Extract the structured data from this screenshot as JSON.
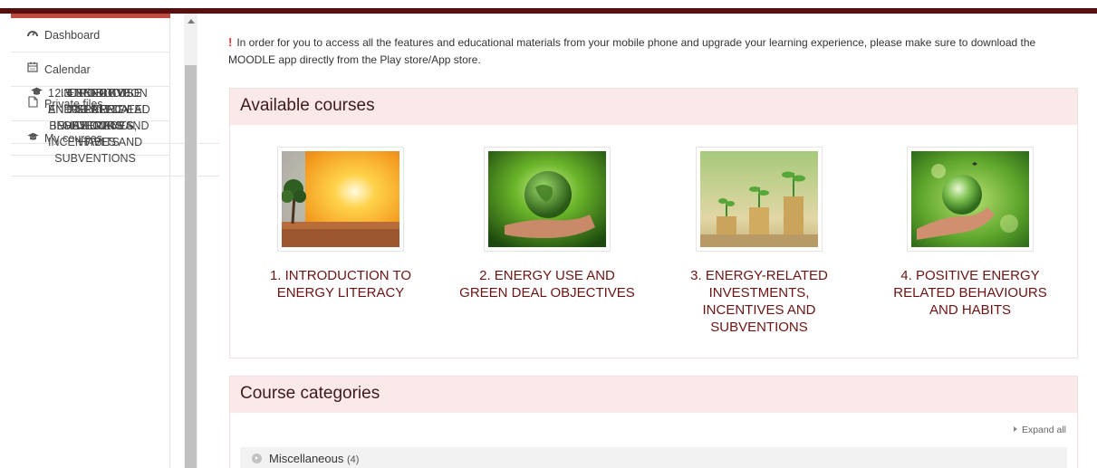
{
  "sidebar": {
    "items": [
      {
        "label": "Dashboard",
        "icon": "dashboard-icon"
      },
      {
        "label": "Calendar",
        "icon": "calendar-icon"
      },
      {
        "label": "Private files",
        "icon": "file-icon"
      },
      {
        "label": "My courses",
        "icon": "graduation-cap-icon"
      }
    ],
    "courses": [
      {
        "lines": [
          "1. INTRODUCTION",
          "TO ENERGY",
          "LITERACY"
        ],
        "icon": "graduation-cap-icon"
      },
      {
        "lines": [
          "2. ENERGY USE",
          "AND GREEN DEAL",
          "OBJECTIVES"
        ],
        "icon": "graduation-cap-icon"
      },
      {
        "lines": [
          "3. ENERGY-",
          "RELATED",
          "INVESTMENTS,",
          "INCENTIVES AND",
          "SUBVENTIONS"
        ],
        "icon": "graduation-cap-icon"
      },
      {
        "lines": [
          "4. POSITIVE",
          "ENERGY RELATED",
          "BEHAVIOURS AND",
          "HABITS"
        ],
        "icon": "graduation-cap-icon"
      }
    ]
  },
  "notice": {
    "mark": "!",
    "line1": "In order for you to access all the features and educational materials  from your mobile phone and upgrade your learning experience, please make sure to download the",
    "line2": "MOODLE app directly from the Play store/App store."
  },
  "available_courses": {
    "heading": "Available courses",
    "courses": [
      {
        "title_lines": [
          "1. INTRODUCTION TO",
          "ENERGY LITERACY"
        ],
        "image": "tree-sunset-image"
      },
      {
        "title_lines": [
          "2. ENERGY USE AND",
          "GREEN DEAL OBJECTIVES"
        ],
        "image": "hand-globe-image"
      },
      {
        "title_lines": [
          "3. ENERGY-RELATED",
          "INVESTMENTS,",
          "INCENTIVES AND",
          "SUBVENTIONS"
        ],
        "image": "coins-plants-image"
      },
      {
        "title_lines": [
          "4. POSITIVE ENERGY",
          "RELATED BEHAVIOURS",
          "AND HABITS"
        ],
        "image": "hand-glass-globe-image"
      }
    ]
  },
  "course_categories": {
    "heading": "Course categories",
    "expand_all": "Expand all",
    "categories": [
      {
        "name": "Miscellaneous",
        "count": "(4)"
      }
    ]
  },
  "colors": {
    "topbar": "#5a0f0f",
    "accent": "#c04b42",
    "course_title": "#6b1414",
    "card_header": "#fbe9e9",
    "notice_mark": "#e03a2f"
  }
}
